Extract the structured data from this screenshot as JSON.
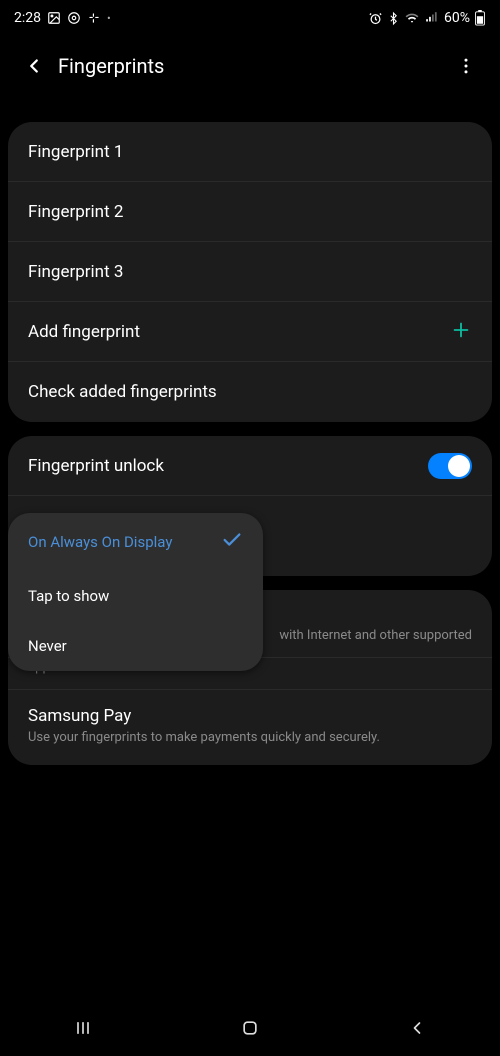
{
  "status": {
    "time": "2:28",
    "battery": "60%"
  },
  "header": {
    "title": "Fingerprints"
  },
  "fingerprints": {
    "item1": "Fingerprint 1",
    "item2": "Fingerprint 2",
    "item3": "Fingerprint 3",
    "add": "Add fingerprint",
    "check": "Check added fingerprints"
  },
  "settings": {
    "unlock_label": "Fingerprint unlock",
    "obscured_fragment": "with Internet and other supported",
    "pay_title": "Samsung Pay",
    "pay_sub": "Use your fingerprints to make payments quickly and securely."
  },
  "popup": {
    "option1": "On Always On Display",
    "option2": "Tap to show",
    "option3": "Never"
  }
}
